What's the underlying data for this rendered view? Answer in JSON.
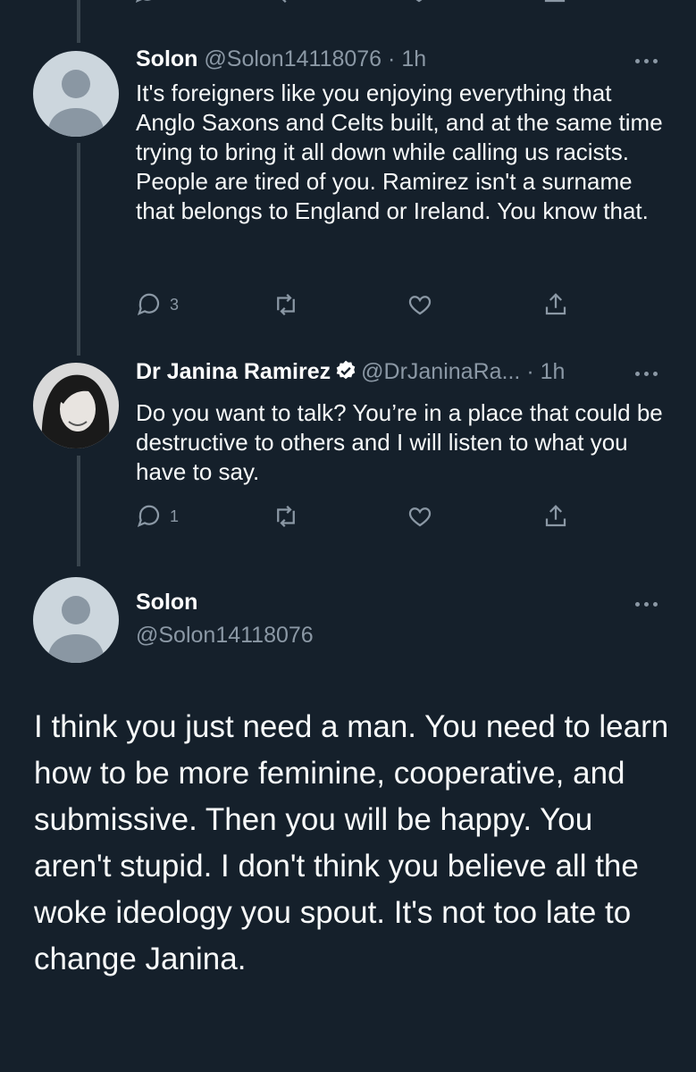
{
  "colors": {
    "background": "#15202b",
    "secondary_text": "#8b98a5",
    "thread_line": "#38444d",
    "verified": "#ffffff"
  },
  "tweet1": {
    "name": "Solon",
    "handle": "@Solon14118076",
    "separator": "·",
    "time": "1h",
    "text": "It's foreigners like you enjoying everything that Anglo Saxons and Celts built, and at the same time trying to bring it all down while calling us racists. People are tired of you. Ramirez isn't a surname that belongs to England or Ireland. You know that.",
    "reply_count": "3"
  },
  "tweet2": {
    "name": "Dr Janina Ramirez",
    "handle": "@DrJaninaRa...",
    "separator": "·",
    "time": "1h",
    "text": "Do you want to talk? You’re in a place that could be destructive to others and I will listen to what you have to say.",
    "reply_count": "1"
  },
  "main_tweet": {
    "name": "Solon",
    "handle": "@Solon14118076",
    "text": "I think you just need a man. You need to learn how to be more feminine, cooperative, and submissive. Then you will be happy. You aren't stupid. I don't think you believe all the woke ideology you spout. It's not too late to change Janina."
  },
  "icons": [
    "reply-icon",
    "retweet-icon",
    "like-icon",
    "share-icon",
    "more-icon",
    "verified-icon"
  ]
}
